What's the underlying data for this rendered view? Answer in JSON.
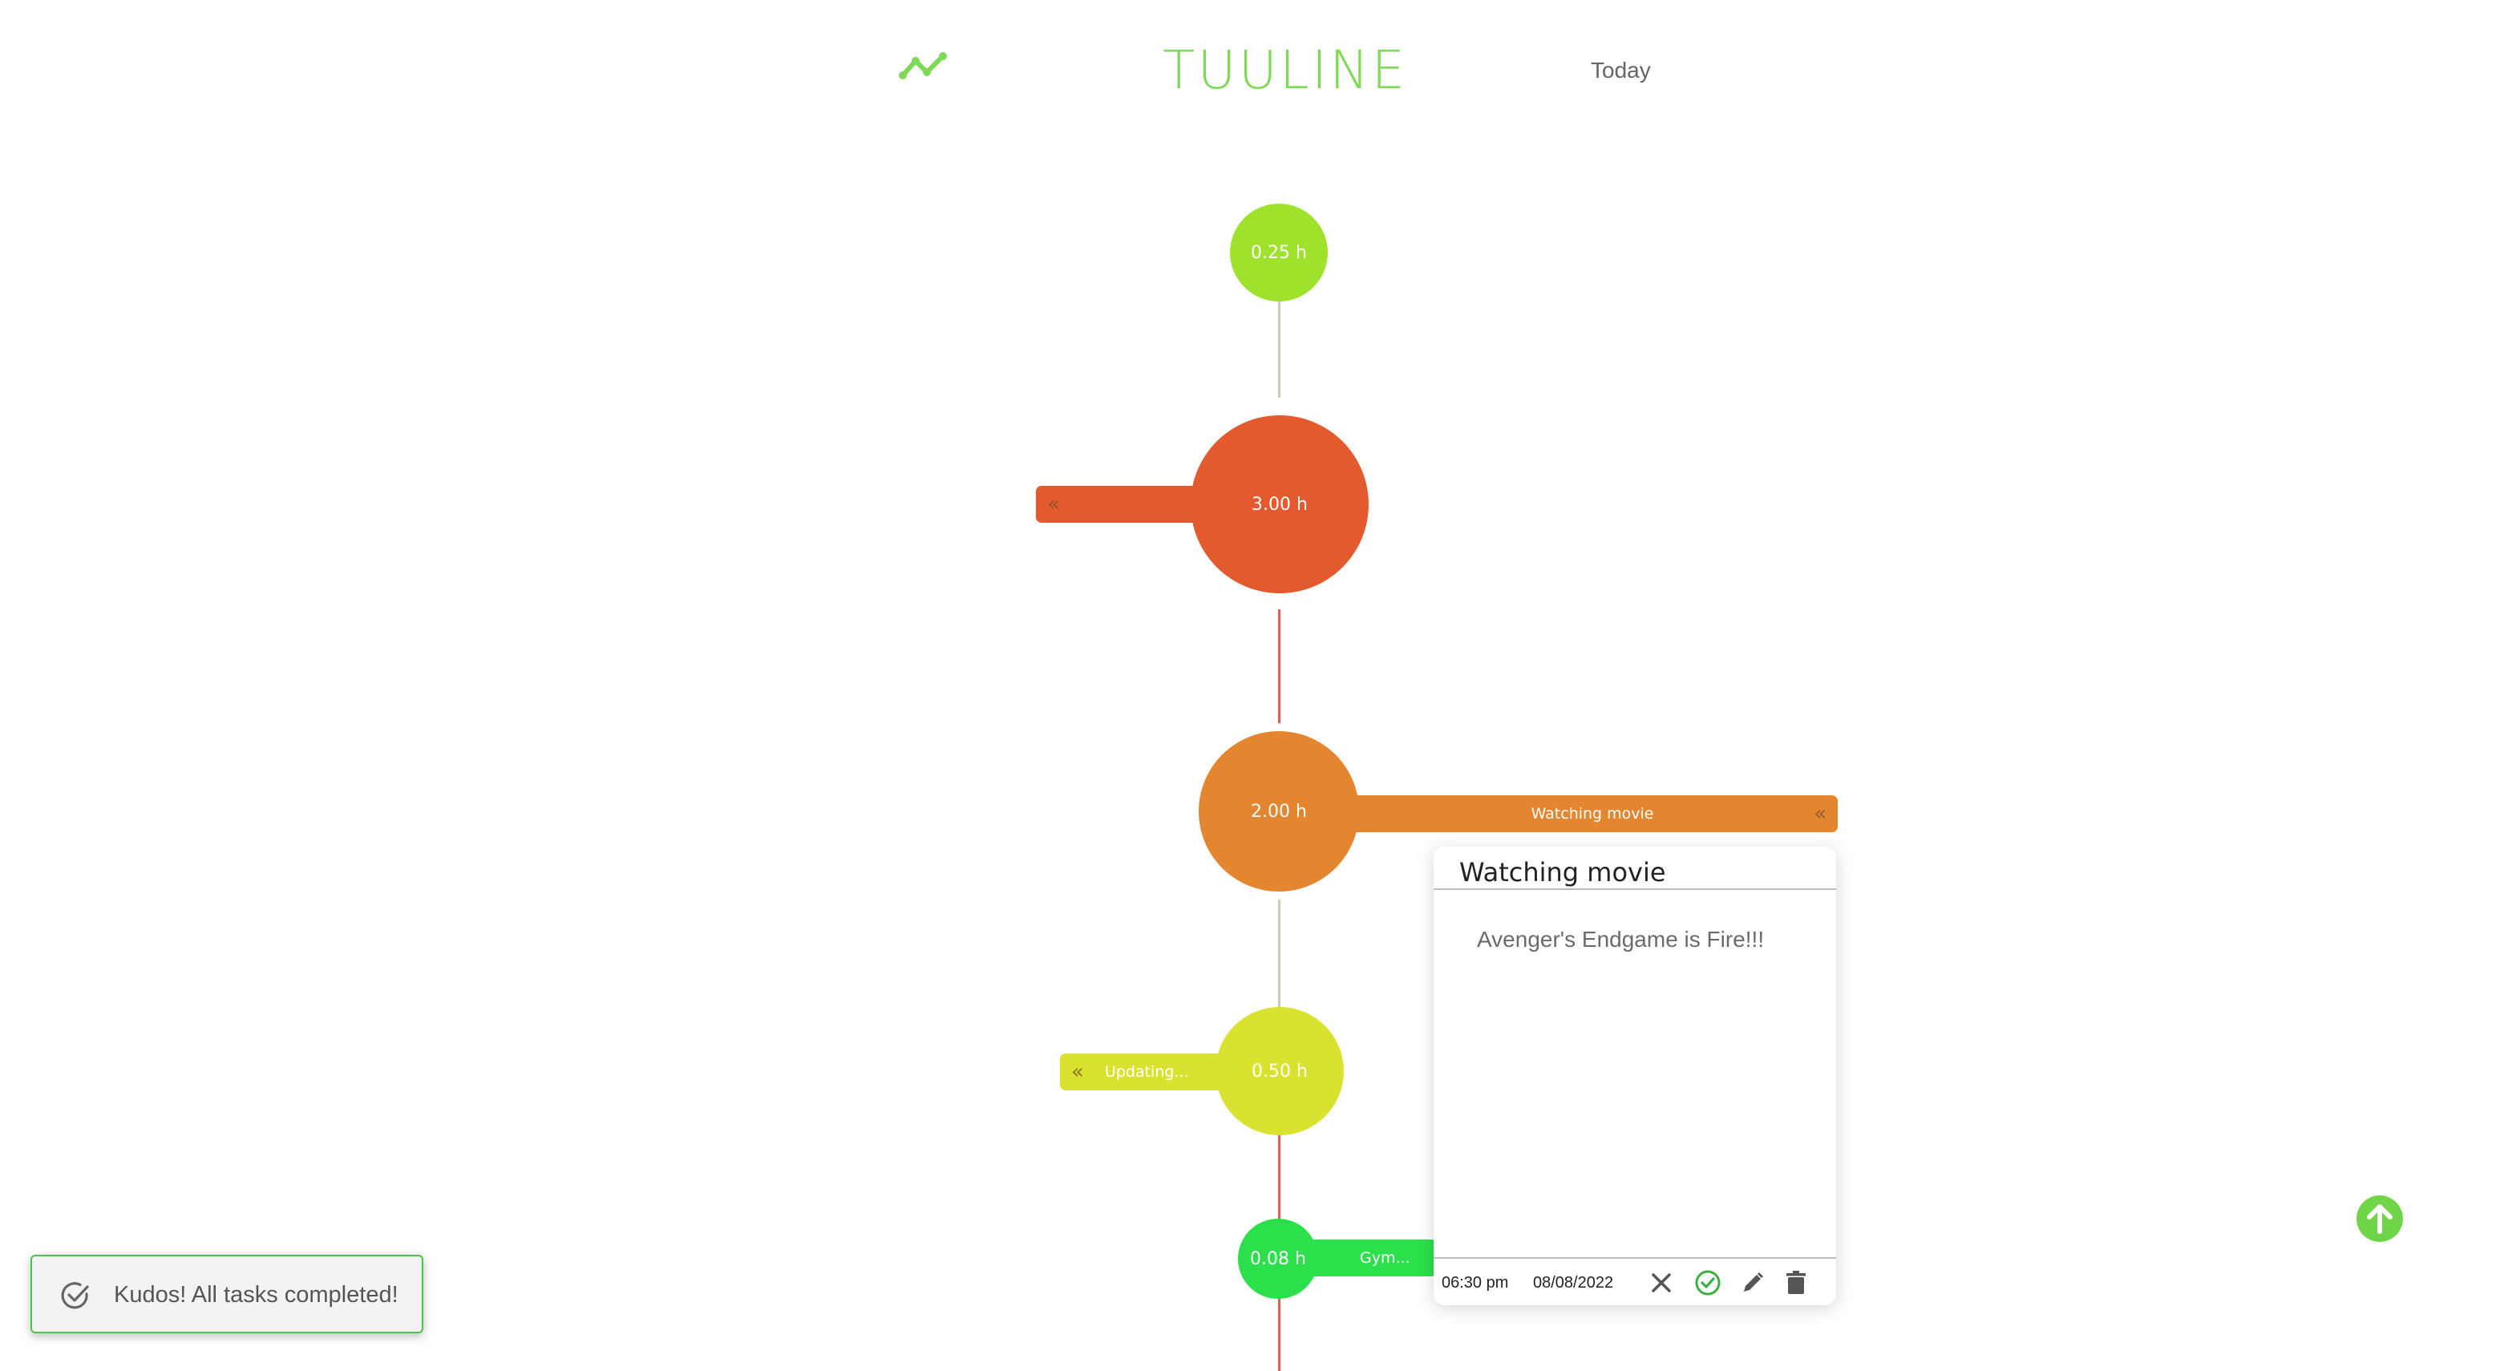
{
  "header": {
    "brand": "TUULINE",
    "nav_today": "Today",
    "logo_icon": "trend-line-icon",
    "brand_color": "#7ed957"
  },
  "timeline": [
    {
      "hours": "0.25 h",
      "label": "",
      "color": "#9ee22c",
      "side": "none"
    },
    {
      "hours": "3.00 h",
      "label": "",
      "color": "#e35a2e",
      "side": "left"
    },
    {
      "hours": "2.00 h",
      "label": "Watching movie",
      "color": "#e4862f",
      "side": "right"
    },
    {
      "hours": "0.50 h",
      "label": "Updating...",
      "color": "#d9e22e",
      "side": "left"
    },
    {
      "hours": "0.08 h",
      "label": "Gym...",
      "color": "#2be04a",
      "side": "right"
    }
  ],
  "connector_colors": {
    "gray": "#c8cfb9",
    "red": "#e0605a"
  },
  "detail_card": {
    "title": "Watching movie",
    "description": "Avenger's Endgame is Fire!!!",
    "time": "06:30 pm",
    "date": "08/08/2022",
    "actions": [
      "close-icon",
      "check-circle-icon",
      "pencil-icon",
      "trash-icon"
    ],
    "check_color": "#3cb043"
  },
  "toast": {
    "message": "Kudos! All tasks completed!",
    "icon": "check-circle-icon",
    "border_color": "#4cc24c"
  },
  "scroll_top": {
    "icon": "arrow-up-circle-icon",
    "color": "#6fd64a"
  }
}
